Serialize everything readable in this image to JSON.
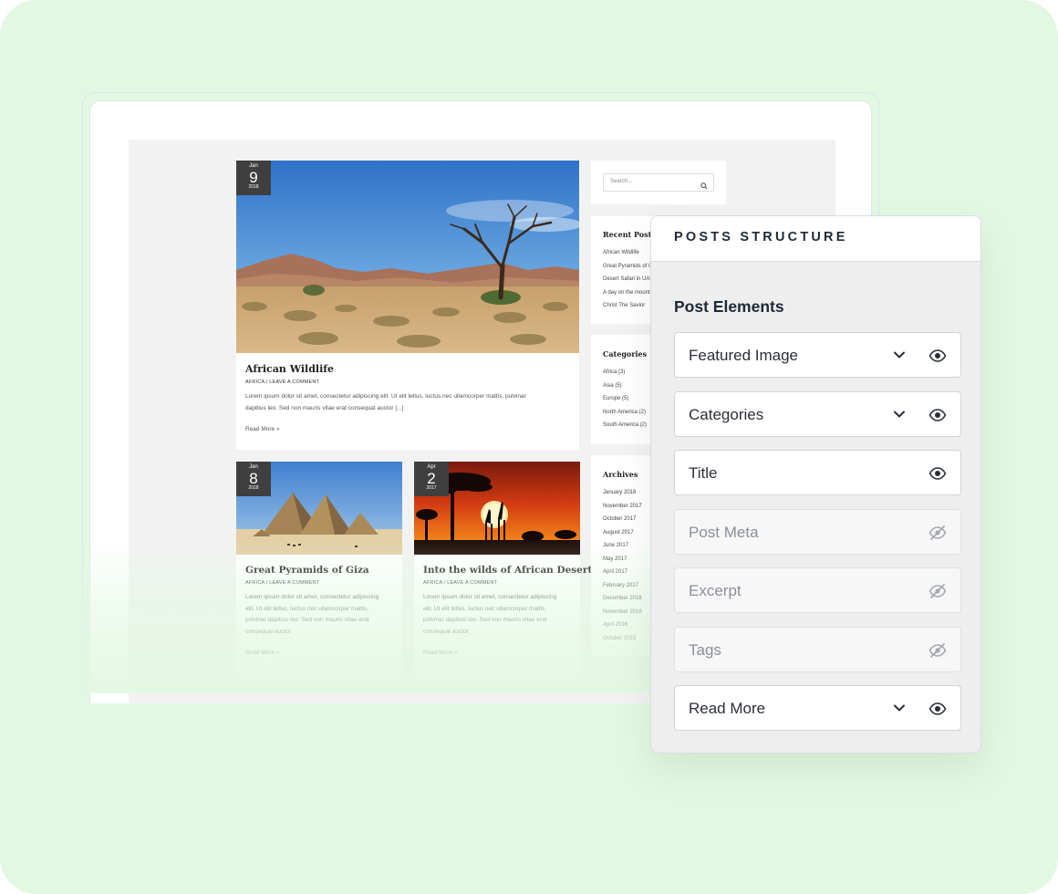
{
  "colors": {
    "background": "#e3f8e3",
    "panel_bg": "#eeeeee",
    "text_dark": "#1f2937",
    "hidden_text": "#8a8f98"
  },
  "blog": {
    "featured_post": {
      "date": {
        "month": "Jan",
        "day": "9",
        "year": "2018"
      },
      "title": "African Wildlife",
      "meta": "AFRICA / LEAVE A COMMENT",
      "excerpt_line1": "Lorem ipsum dolor sit amet, consectetur adipiscing elit. Ut elit tellus, luctus nec ullamcorper mattis, pulvinar",
      "excerpt_line2": "dapibus leo. Sed non mauris vitae erat consequat auctor [...]",
      "read_more": "Read More »"
    },
    "posts": [
      {
        "date": {
          "month": "Jan",
          "day": "8",
          "year": "2018"
        },
        "title": "Great Pyramids of Giza",
        "meta": "AFRICA / LEAVE A COMMENT",
        "excerpt": [
          "Lorem ipsum dolor sit amet, consectetur adipiscing",
          "elit. Ut elit tellus, luctus nec ullamcorper mattis,",
          "pulvinar dapibus leo. Sed non mauris vitae erat",
          "consequat auctor"
        ],
        "read_more": "Read More »"
      },
      {
        "date": {
          "month": "Apr",
          "day": "2",
          "year": "2017"
        },
        "title": "Into the wilds of African Desert",
        "meta": "AFRICA / LEAVE A COMMENT",
        "excerpt": [
          "Lorem ipsum dolor sit amet, consectetur adipiscing",
          "elit. Ut elit tellus, luctus nec ullamcorper mattis,",
          "pulvinar dapibus leo. Sed non mauris vitae erat",
          "consequat auctor"
        ],
        "read_more": "Read More »"
      }
    ],
    "sidebar": {
      "search_placeholder": "Search...",
      "recent_posts": {
        "title": "Recent Posts",
        "items": [
          "African Wildlife",
          "Great Pyramids of Giza",
          "Desert Safari in UAE",
          "A day on the mountains",
          "Christ The Savior"
        ]
      },
      "categories": {
        "title": "Categories",
        "items": [
          "Africa (3)",
          "Asia (5)",
          "Europe (5)",
          "North America (2)",
          "South America (2)"
        ]
      },
      "archives": {
        "title": "Archives",
        "items": [
          "January 2018",
          "November 2017",
          "October 2017",
          "August 2017",
          "June 2017",
          "May 2017",
          "April 2017",
          "February 2017",
          "December 2016",
          "November 2016",
          "April 2016",
          "October 2015"
        ]
      }
    }
  },
  "panel": {
    "title": "POSTS STRUCTURE",
    "section": "Post Elements",
    "elements": [
      {
        "label": "Featured Image",
        "expandable": true,
        "visible": true
      },
      {
        "label": "Categories",
        "expandable": true,
        "visible": true
      },
      {
        "label": "Title",
        "expandable": false,
        "visible": true
      },
      {
        "label": "Post Meta",
        "expandable": false,
        "visible": false
      },
      {
        "label": "Excerpt",
        "expandable": false,
        "visible": false
      },
      {
        "label": "Tags",
        "expandable": false,
        "visible": false
      },
      {
        "label": "Read More",
        "expandable": true,
        "visible": true
      }
    ]
  }
}
